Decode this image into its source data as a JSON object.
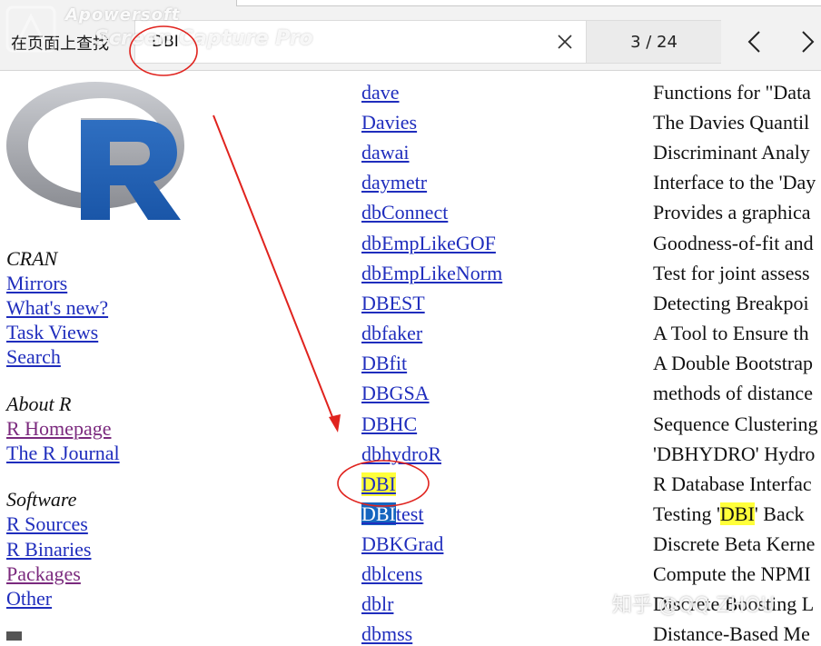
{
  "find_bar": {
    "label": "在页面上查找",
    "query": "DBI",
    "match_count": "3 / 24",
    "clear_icon": "close-icon",
    "prev_icon": "chevron-left-icon",
    "next_icon": "chevron-right-icon"
  },
  "watermark": {
    "brand": "Apowersoft",
    "product": "Screen Capture Pro",
    "zhihu": "知乎 @QQ ZHOU"
  },
  "sidebar": {
    "logo_icon": "r-logo-icon",
    "cran_heading": "CRAN",
    "cran_links": [
      "Mirrors",
      "What's new?",
      "Task Views",
      "Search"
    ],
    "about_heading": "About R",
    "about_links": [
      "R Homepage",
      "The R Journal"
    ],
    "software_heading": "Software",
    "software_links": [
      "R Sources",
      "R Binaries",
      "Packages",
      "Other"
    ]
  },
  "packages": [
    {
      "name": "dave",
      "desc": "Functions for \"Data"
    },
    {
      "name": "Davies",
      "desc": "The Davies Quantil"
    },
    {
      "name": "dawai",
      "desc": "Discriminant Analy"
    },
    {
      "name": "daymetr",
      "desc": "Interface to the 'Day"
    },
    {
      "name": "dbConnect",
      "desc": "Provides a graphica"
    },
    {
      "name": "dbEmpLikeGOF",
      "desc": "Goodness-of-fit and"
    },
    {
      "name": "dbEmpLikeNorm",
      "desc": "Test for joint assess"
    },
    {
      "name": "DBEST",
      "desc": "Detecting Breakpoi"
    },
    {
      "name": "dbfaker",
      "desc": "A Tool to Ensure th"
    },
    {
      "name": "DBfit",
      "desc": "A Double Bootstrap"
    },
    {
      "name": "DBGSA",
      "desc": "methods of distance"
    },
    {
      "name": "DBHC",
      "desc": "Sequence Clustering"
    },
    {
      "name": "dbhydroR",
      "desc": "'DBHYDRO' Hydro"
    },
    {
      "name": "DBI",
      "desc": "R Database Interfac"
    },
    {
      "name": "DBItest",
      "desc": "Testing 'DBI' Back"
    },
    {
      "name": "DBKGrad",
      "desc": "Discrete Beta Kerne"
    },
    {
      "name": "dblcens",
      "desc": "Compute the NPMI"
    },
    {
      "name": "dblr",
      "desc": "Discrete Boosting L"
    },
    {
      "name": "dbmss",
      "desc": "Distance-Based Me"
    }
  ],
  "colors": {
    "link": "#1f2dbd",
    "visited_link": "#7b2a7e",
    "highlight": "#ffff3a",
    "active_match": "#1565c0",
    "annotation": "#e0231e"
  }
}
